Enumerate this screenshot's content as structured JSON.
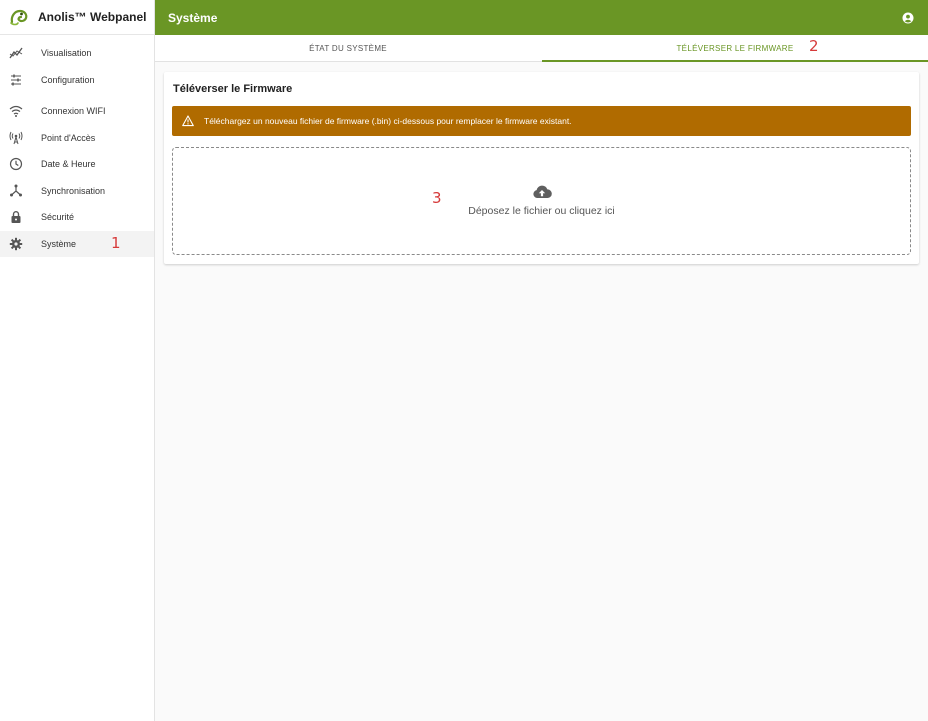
{
  "app": {
    "brand": "Anolis™ Webpanel"
  },
  "sidebar": {
    "items": [
      {
        "label": "Visualisation",
        "icon": "chart-line-icon"
      },
      {
        "label": "Configuration",
        "icon": "sliders-icon"
      },
      {
        "label": "Connexion WIFI",
        "icon": "wifi-icon"
      },
      {
        "label": "Point d'Accès",
        "icon": "access-point-icon"
      },
      {
        "label": "Date & Heure",
        "icon": "clock-icon"
      },
      {
        "label": "Synchronisation",
        "icon": "sync-icon"
      },
      {
        "label": "Sécurité",
        "icon": "lock-icon"
      },
      {
        "label": "Système",
        "icon": "gear-icon",
        "active": true
      }
    ]
  },
  "header": {
    "title": "Système",
    "account_icon": "account-circle-icon"
  },
  "tabs": [
    {
      "label": "ÉTAT DU SYSTÈME",
      "active": false
    },
    {
      "label": "TÉLÉVERSER LE FIRMWARE",
      "active": true
    }
  ],
  "upload": {
    "title": "Téléverser le Firmware",
    "alert": "Téléchargez un nouveau fichier de firmware (.bin) ci-dessous pour remplacer le firmware existant.",
    "dropzone_label": "Déposez le fichier ou cliquez ici"
  },
  "annotations": [
    "1",
    "2",
    "3"
  ],
  "colors": {
    "primary": "#6a9625",
    "warning": "#b06b00",
    "annotation": "#d63a3a"
  }
}
